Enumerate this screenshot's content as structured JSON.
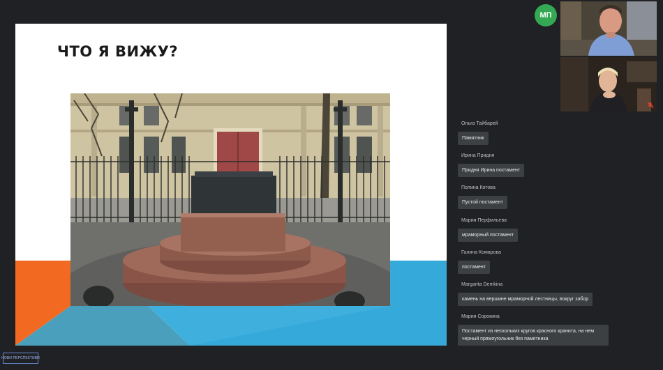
{
  "slide": {
    "title": "ЧТО Я ВИЖУ?",
    "accent_colors": {
      "orange": "#f26a21",
      "blue": "#35a9d9",
      "teal": "#4a9fbd"
    }
  },
  "participants": {
    "self_avatar": {
      "initials": "МП",
      "color": "#34a853"
    },
    "tiles": [
      {
        "muted": false
      },
      {
        "muted": true
      }
    ]
  },
  "chat": {
    "messages": [
      {
        "author": "Ольга Тайбарей",
        "text": "Памятник"
      },
      {
        "author": "Ирина Придня",
        "text": "Придня Ирина постамент"
      },
      {
        "author": "Полина Котова",
        "text": "Пустой постамент"
      },
      {
        "author": "Мария Перфильева",
        "text": "мраморный постамент"
      },
      {
        "author": "Галина Комарова",
        "text": "постамент"
      },
      {
        "author": "Margarita Demkina",
        "text": "камень на вершине мраморной лестницы, вокруг забор"
      },
      {
        "author": "Мария Сорокина",
        "text": "Постамент из нескольких кругов красного кранита, на нем черный прямоугольник без памятника"
      }
    ]
  },
  "logo": {
    "text": "НОВИ ПЕРСПЕКТИВИ"
  }
}
